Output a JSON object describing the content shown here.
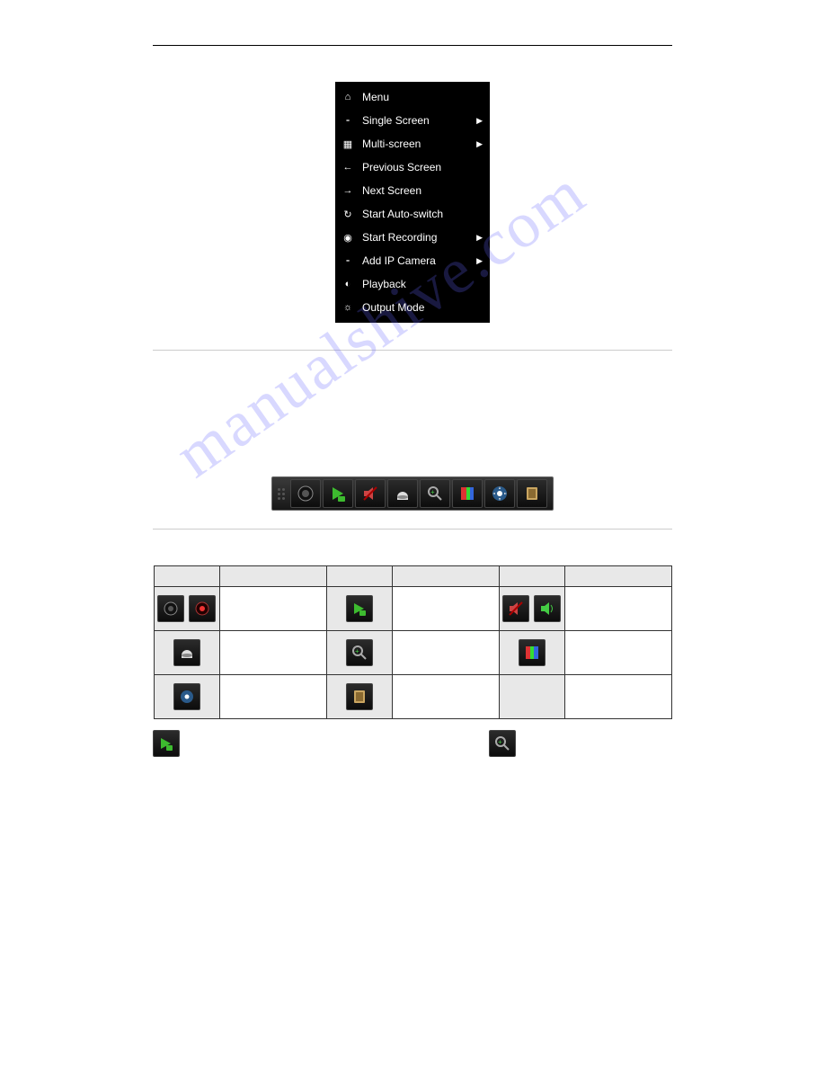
{
  "watermark": "manualshive.com",
  "context_menu": {
    "items": [
      {
        "label": "Menu",
        "icon_name": "home-icon",
        "glyph": "⌂",
        "submenu": false
      },
      {
        "label": "Single Screen",
        "icon_name": "camera-icon",
        "glyph": "⁃",
        "submenu": true
      },
      {
        "label": "Multi-screen",
        "icon_name": "grid-icon",
        "glyph": "▦",
        "submenu": true
      },
      {
        "label": "Previous Screen",
        "icon_name": "prev-icon",
        "glyph": "←",
        "submenu": false
      },
      {
        "label": "Next Screen",
        "icon_name": "next-icon",
        "glyph": "→",
        "submenu": false
      },
      {
        "label": "Start Auto-switch",
        "icon_name": "refresh-icon",
        "glyph": "↻",
        "submenu": false
      },
      {
        "label": "Start Recording",
        "icon_name": "record-icon",
        "glyph": "◉",
        "submenu": true
      },
      {
        "label": "Add IP Camera",
        "icon_name": "add-cam-icon",
        "glyph": "⁃",
        "submenu": true
      },
      {
        "label": "Playback",
        "icon_name": "play-icon",
        "glyph": "◐",
        "submenu": false
      },
      {
        "label": "Output Mode",
        "icon_name": "output-icon",
        "glyph": "☼",
        "submenu": false
      }
    ]
  },
  "toolbar_icons": [
    "record-icon",
    "instant-playback-icon",
    "mute-icon",
    "ptz-icon",
    "digital-zoom-icon",
    "image-settings-icon",
    "strategy-icon",
    "close-icon"
  ],
  "table": {
    "headers": [
      "",
      "",
      "",
      "",
      "",
      ""
    ],
    "rows": [
      {
        "cells": [
          "record-pair",
          "",
          "playback-green",
          "",
          "audio-pair",
          ""
        ]
      },
      {
        "cells": [
          "ptz-dome",
          "",
          "zoom-plus",
          "",
          "color-bars",
          ""
        ]
      },
      {
        "cells": [
          "strategy-gear",
          "",
          "close-door",
          "",
          "",
          ""
        ]
      }
    ]
  },
  "inline_icons": [
    "instant-playback-icon",
    "digital-zoom-icon"
  ]
}
